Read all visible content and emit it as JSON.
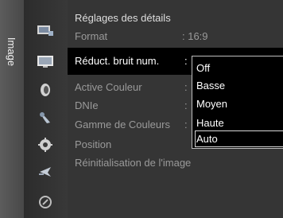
{
  "side_tab": {
    "label": "Image"
  },
  "icons": [
    "input-icon",
    "picture-icon",
    "sound-icon",
    "channel-icon",
    "setup-icon",
    "satellite-dish-icon",
    "support-icon"
  ],
  "menu": {
    "header": "Réglages des détails",
    "items": [
      {
        "label": "Format",
        "value": ": 16:9"
      },
      {
        "label": "Réduct. bruit num.",
        "value": ":"
      },
      {
        "label": "Active Couleur",
        "value": ":"
      },
      {
        "label": "DNIe",
        "value": ":"
      },
      {
        "label": "Gamme de Couleurs",
        "value": ":"
      },
      {
        "label": "Position",
        "value": ""
      },
      {
        "label": "Réinitialisation de l'image",
        "value": ""
      }
    ]
  },
  "dropdown": {
    "options": [
      "Off",
      "Basse",
      "Moyen",
      "Haute",
      "Auto"
    ],
    "selected": "Auto"
  },
  "colors": {
    "menu_bg": "#353535",
    "highlight": "#000000",
    "text_active": "#ffffff",
    "text_inactive": "#9a9a9a"
  }
}
